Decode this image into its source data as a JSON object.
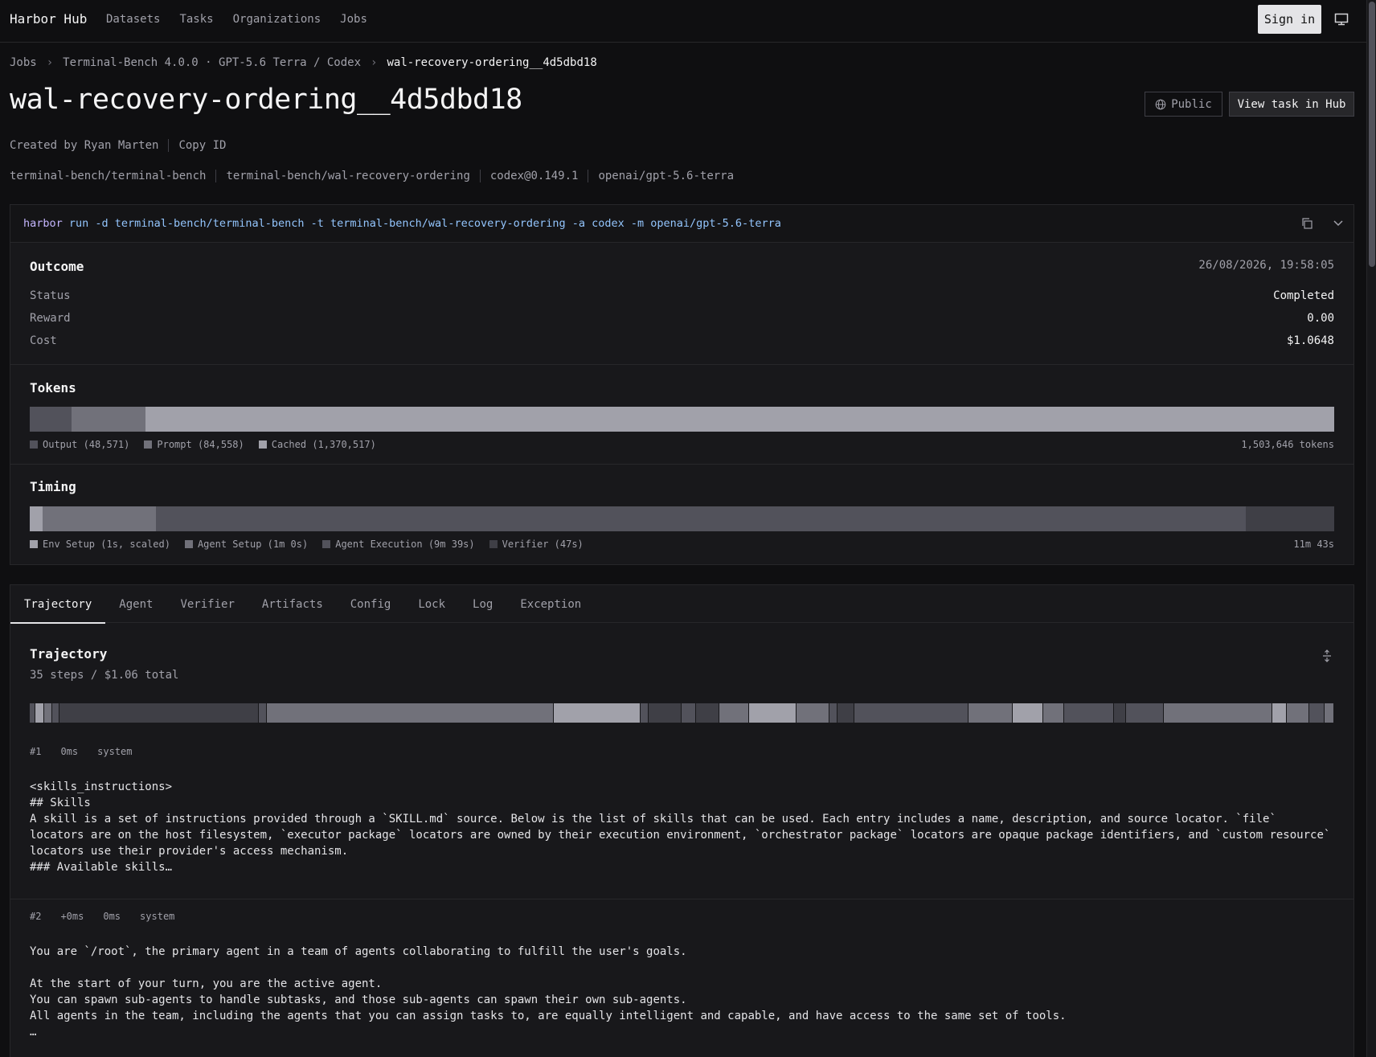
{
  "nav": {
    "brand": "Harbor Hub",
    "links": [
      "Datasets",
      "Tasks",
      "Organizations",
      "Jobs"
    ],
    "signin": "Sign in",
    "display_icon": "monitor-icon"
  },
  "breadcrumb": {
    "items": [
      "Jobs",
      "Terminal-Bench 4.0.0 · GPT-5.6 Terra / Codex",
      "wal-recovery-ordering__4d5dbd18"
    ],
    "separator": "›"
  },
  "header": {
    "title": "wal-recovery-ordering__4d5dbd18",
    "visibility": "Public",
    "view_task": "View task in Hub",
    "created_by": "Created by Ryan Marten",
    "copy_id": "Copy ID",
    "tags": [
      "terminal-bench/terminal-bench",
      "terminal-bench/wal-recovery-ordering",
      "codex@0.149.1",
      "openai/gpt-5.6-terra"
    ]
  },
  "command": {
    "prefix": "harbor",
    "text": " run -d terminal-bench/terminal-bench -t terminal-bench/wal-recovery-ordering -a codex -m openai/gpt-5.6-terra"
  },
  "outcome": {
    "title": "Outcome",
    "timestamp": "26/08/2026, 19:58:05",
    "rows": [
      {
        "label": "Status",
        "value": "Completed"
      },
      {
        "label": "Reward",
        "value": "0.00"
      },
      {
        "label": "Cost",
        "value": "$1.0648"
      }
    ]
  },
  "tokens": {
    "title": "Tokens",
    "segments": [
      {
        "label": "Output (48,571)",
        "value": 48571,
        "color": "#52525b"
      },
      {
        "label": "Prompt (84,558)",
        "value": 84558,
        "color": "#71717a"
      },
      {
        "label": "Cached (1,370,517)",
        "value": 1370517,
        "color": "#a1a1aa"
      }
    ],
    "total": "1,503,646 tokens"
  },
  "timing": {
    "title": "Timing",
    "segments": [
      {
        "label": "Env Setup (1s, scaled)",
        "share": 0.01,
        "color": "#a1a1aa"
      },
      {
        "label": "Agent Setup (1m 0s)",
        "share": 0.087,
        "color": "#71717a"
      },
      {
        "label": "Agent Execution (9m 39s)",
        "share": 0.835,
        "color": "#52525b"
      },
      {
        "label": "Verifier (47s)",
        "share": 0.068,
        "color": "#3f3f46"
      }
    ],
    "total": "11m 43s"
  },
  "tabs": [
    "Trajectory",
    "Agent",
    "Verifier",
    "Artifacts",
    "Config",
    "Lock",
    "Log",
    "Exception"
  ],
  "trajectory": {
    "title": "Trajectory",
    "subtitle": "35 steps / $1.06 total",
    "step_shares": [
      0.004,
      0.007,
      0.006,
      0.006,
      0.152,
      0.006,
      0.219,
      0.066,
      0.006,
      0.025,
      0.011,
      0.018,
      0.023,
      0.036,
      0.025,
      0.006,
      0.013,
      0.087,
      0.034,
      0.023,
      0.016,
      0.038,
      0.009,
      0.029,
      0.083,
      0.011,
      0.017,
      0.012,
      0.007
    ],
    "step_colors": [
      "#52525b",
      "#a1a1aa",
      "#71717a",
      "#52525b",
      "#3f3f46",
      "#52525b",
      "#71717a",
      "#a1a1aa",
      "#52525b",
      "#3f3f46",
      "#52525b",
      "#3f3f46",
      "#71717a",
      "#a1a1aa",
      "#71717a",
      "#52525b",
      "#3f3f46",
      "#52525b",
      "#71717a",
      "#a1a1aa",
      "#71717a",
      "#52525b",
      "#3f3f46",
      "#52525b",
      "#71717a",
      "#a1a1aa",
      "#71717a",
      "#52525b",
      "#71717a"
    ],
    "steps": [
      {
        "id": "#1",
        "meta": [
          "0ms"
        ],
        "role": "system",
        "body": "<skills_instructions>\n## Skills\nA skill is a set of instructions provided through a `SKILL.md` source. Below is the list of skills that can be used. Each entry includes a name, description, and source locator. `file` locators are on the host filesystem, `executor package` locators are owned by their execution environment, `orchestrator package` locators are opaque package identifiers, and `custom resource` locators use their provider's access mechanism.\n### Available skills…"
      },
      {
        "id": "#2",
        "meta": [
          "+0ms",
          "0ms"
        ],
        "role": "system",
        "body": "You are `/root`, the primary agent in a team of agents collaborating to fulfill the user's goals.\n\nAt the start of your turn, you are the active agent.\nYou can spawn sub-agents to handle subtasks, and those sub-agents can spawn their own sub-agents.\nAll agents in the team, including the agents that you can assign tasks to, are equally intelligent and capable, and have access to the same set of tools.\n…"
      }
    ]
  }
}
